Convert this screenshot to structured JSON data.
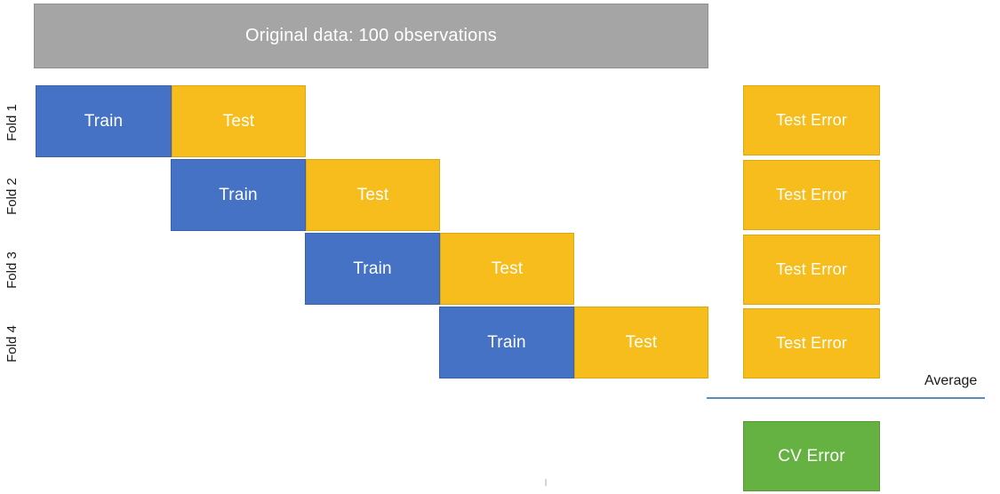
{
  "diagram": {
    "title_box": {
      "label": "Original data: 100 observations",
      "color": "#a5a5a5"
    },
    "colors": {
      "train": "#4572c4",
      "test": "#f7bd1c",
      "original": "#a5a5a5",
      "cv_error": "#65b242",
      "average_line": "#5b8ac6",
      "text_on_fill": "#ffffff",
      "text_plain": "#1a1a1a"
    },
    "fold_rows": [
      {
        "fold_label": "Fold 1",
        "train_label": "Train",
        "test_label": "Test",
        "error_label": "Test Error"
      },
      {
        "fold_label": "Fold 2",
        "train_label": "Train",
        "test_label": "Test",
        "error_label": "Test Error"
      },
      {
        "fold_label": "Fold 3",
        "train_label": "Train",
        "test_label": "Test",
        "error_label": "Test Error"
      },
      {
        "fold_label": "Fold 4",
        "train_label": "Train",
        "test_label": "Test",
        "error_label": "Test Error"
      }
    ],
    "average": {
      "label": "Average"
    },
    "cv_error_box": {
      "label": "CV Error",
      "color": "#65b242"
    }
  }
}
